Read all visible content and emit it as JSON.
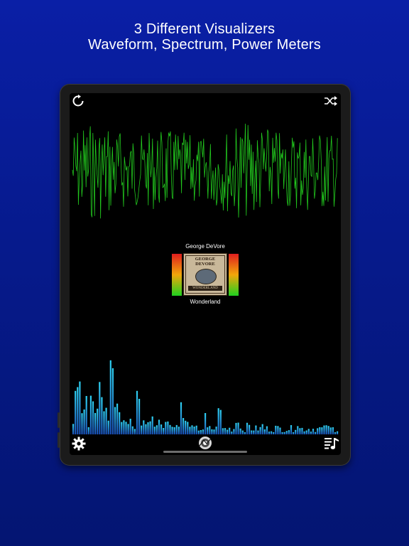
{
  "headline": {
    "line1": "3 Different Visualizers",
    "line2": "Waveform, Spectrum, Power Meters"
  },
  "colors": {
    "background_top": "#0a1fa6",
    "background_bottom": "#041572",
    "waveform": "#22c81e",
    "spectrum_top": "#2fd2f2",
    "spectrum_bottom": "#1a4fb8",
    "meter_top": "#e01e1e",
    "meter_mid": "#f2a60a",
    "meter_bottom": "#1fd21f"
  },
  "toolbar": {
    "top_left_icon": "refresh-icon",
    "top_right_icon": "shuffle-icon",
    "bottom_left_icon": "gear-icon",
    "bottom_center_icon": "visualizer-mode-icon",
    "bottom_right_icon": "playlist-icon"
  },
  "now_playing": {
    "artist": "George DeVore",
    "title": "Wonderland",
    "album_art_lettering": [
      "GEORGE",
      "DEVORE",
      "WONDERLAND"
    ]
  },
  "meters": {
    "left_level": 1.0,
    "right_level": 1.0
  }
}
